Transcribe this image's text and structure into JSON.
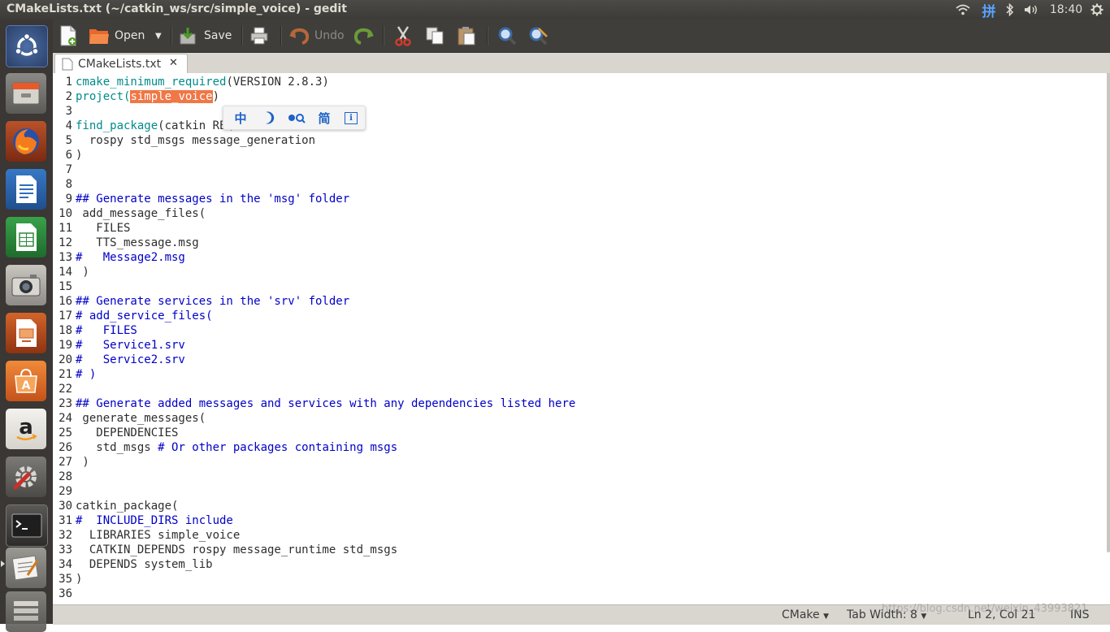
{
  "window": {
    "title": "CMakeLists.txt (~/catkin_ws/src/simple_voice) - gedit"
  },
  "panel": {
    "input_method": "拼",
    "clock": "18:40"
  },
  "launcher": {
    "items": [
      "Ubuntu dash",
      "Files",
      "Firefox",
      "LibreOffice Writer",
      "LibreOffice Calc",
      "Camera",
      "LibreOffice Impress",
      "Ubuntu Software",
      "Amazon",
      "System Settings",
      "Terminal",
      "Text Editor"
    ]
  },
  "toolbar": {
    "open_label": "Open",
    "save_label": "Save",
    "undo_label": "Undo"
  },
  "tab": {
    "label": "CMakeLists.txt",
    "close": "✕"
  },
  "ime_popup": {
    "mode": "中",
    "simplified": "简",
    "info": "i"
  },
  "editor": {
    "line_numbers": [
      "1",
      "2",
      "3",
      "4",
      "5",
      "6",
      "7",
      "8",
      "9",
      "10",
      "11",
      "12",
      "13",
      "14",
      "15",
      "16",
      "17",
      "18",
      "19",
      "20",
      "21",
      "22",
      "23",
      "24",
      "25",
      "26",
      "27",
      "28",
      "29",
      "30",
      "31",
      "32",
      "33",
      "34",
      "35",
      "36"
    ],
    "lines": [
      "cmake_minimum_required(VERSION 2.8.3)",
      "project(simple_voice)",
      "",
      "find_package(catkin REQUIRED COMPONENTS",
      "  rospy std_msgs message_generation",
      ")",
      "",
      "",
      "## Generate messages in the 'msg' folder",
      " add_message_files(",
      "   FILES",
      "   TTS_message.msg",
      "#   Message2.msg",
      " )",
      "",
      "## Generate services in the 'srv' folder",
      "# add_service_files(",
      "#   FILES",
      "#   Service1.srv",
      "#   Service2.srv",
      "# )",
      "",
      "## Generate added messages and services with any dependencies listed here",
      " generate_messages(",
      "   DEPENDENCIES",
      "   std_msgs # Or other packages containing msgs",
      " )",
      "",
      "",
      "catkin_package(",
      "#  INCLUDE_DIRS include",
      "  LIBRARIES simple_voice",
      "  CATKIN_DEPENDS rospy message_runtime std_msgs",
      "  DEPENDS system_lib",
      ")",
      ""
    ],
    "line2_pre": "project(",
    "line2_sel": "simple_voice",
    "line2_post": ")",
    "line26_code": "   std_msgs ",
    "line26_comment": "# Or other packages containing msgs"
  },
  "statusbar": {
    "language": "CMake",
    "tab_width": "Tab Width: 8",
    "position": "Ln 2, Col 21",
    "mode": "INS",
    "watermark": "https://blog.csdn.net/weixin_43993821"
  }
}
